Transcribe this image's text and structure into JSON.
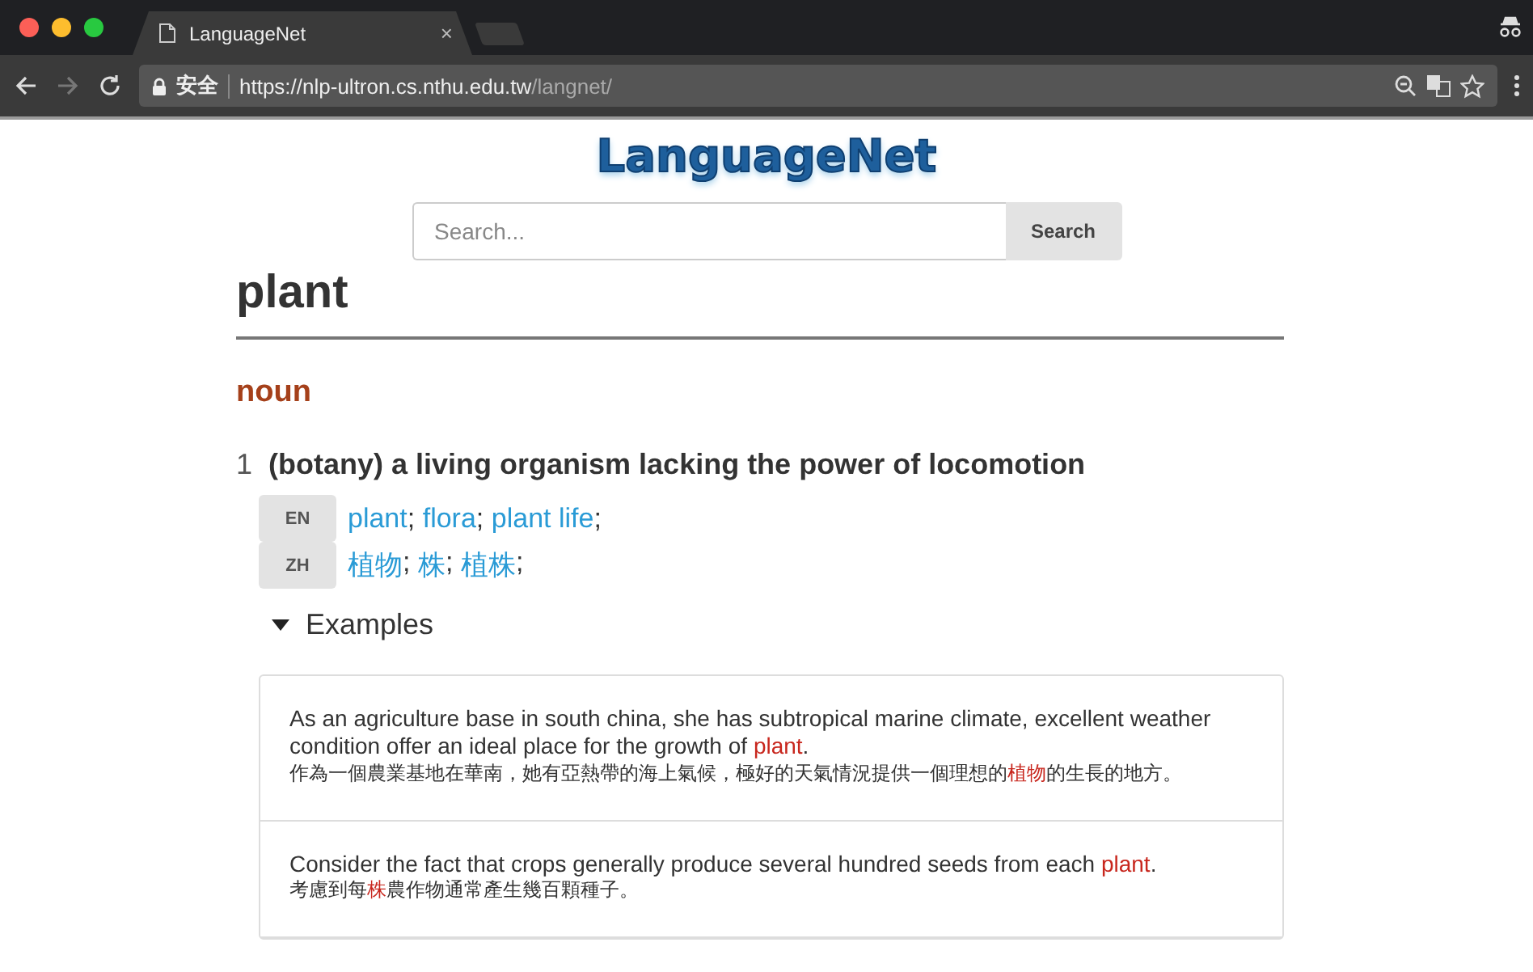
{
  "browser": {
    "tab": {
      "title": "LanguageNet",
      "close": "×"
    },
    "security_label": "安全",
    "url_host": "https://nlp-ultron.cs.nthu.edu.tw",
    "url_path": "/langnet/"
  },
  "site": {
    "logo": "LanguageNet",
    "search": {
      "placeholder": "Search...",
      "button": "Search"
    }
  },
  "entry": {
    "word": "plant",
    "pos": "noun",
    "senses": [
      {
        "number": "1",
        "gloss": "(botany) a living organism lacking the power of locomotion",
        "translations": [
          {
            "lang": "EN",
            "sep": ";",
            "terms": [
              "plant",
              "flora",
              "plant life"
            ]
          },
          {
            "lang": "ZH",
            "sep": ";",
            "terms": [
              "植物",
              "株",
              "植株"
            ]
          }
        ],
        "examples_label": "Examples",
        "expanded": true,
        "examples": [
          {
            "en": {
              "before": "As an agriculture base in south china, she has subtropical marine climate, excellent weather condition offer an ideal place for the growth of ",
              "keyword": "plant",
              "after": "."
            },
            "zh": {
              "before": "作為一個農業基地在華南，她有亞熱帶的海上氣候，極好的天氣情況提供一個理想的",
              "keyword": "植物",
              "after": "的生長的地方。"
            }
          },
          {
            "en": {
              "before": "Consider the fact that crops generally produce several hundred seeds from each ",
              "keyword": "plant",
              "after": "."
            },
            "zh": {
              "before": "考慮到每",
              "keyword": "株",
              "after": "農作物通常產生幾百顆種子。"
            }
          }
        ]
      }
    ]
  }
}
